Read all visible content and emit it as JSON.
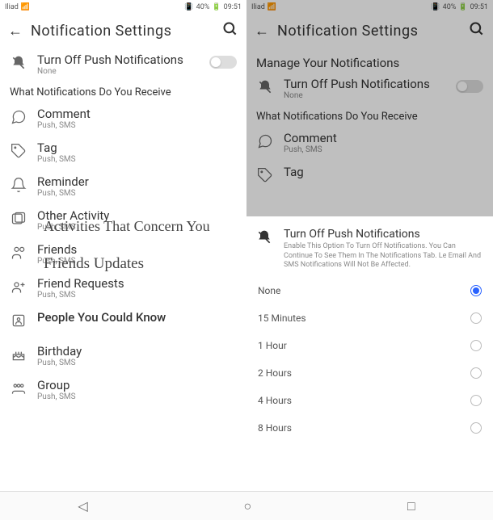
{
  "status": {
    "carrier": "Iliad",
    "battery": "40%",
    "time": "09:51"
  },
  "left": {
    "header_title": "Notification Settings",
    "toggle": {
      "title": "Turn Off Push Notifications",
      "sub": "None"
    },
    "section_label": "What Notifications Do You Receive",
    "items": [
      {
        "title": "Comment",
        "sub": "Push, SMS"
      },
      {
        "title": "Tag",
        "sub": "Push, SMS"
      },
      {
        "title": "Reminder",
        "sub": "Push, SMS"
      },
      {
        "title": "Other Activity",
        "sub": "Push, SMS"
      },
      {
        "title": "Friends",
        "sub": "Push, SMS"
      },
      {
        "title": "Friend Requests",
        "sub": "Push, SMS"
      },
      {
        "title": "People You Could Know",
        "sub": ""
      },
      {
        "title": "Birthday",
        "sub": "Push, SMS"
      },
      {
        "title": "Group",
        "sub": "Push, SMS"
      }
    ],
    "overlay1": "Activities That Concern You",
    "overlay2": "Friends Updates"
  },
  "right": {
    "header_title": "Notification Settings",
    "manage": "Manage Your Notifications",
    "toggle": {
      "title": "Turn Off Push Notifications",
      "sub": "None"
    },
    "section_label": "What Notifications Do You Receive",
    "items": [
      {
        "title": "Comment",
        "sub": "Push, SMS"
      },
      {
        "title": "Tag",
        "sub": ""
      }
    ],
    "sheet": {
      "title": "Turn Off Push Notifications",
      "desc": "Enable This Option To Turn Off Notifications. You Can Continue To See Them In The Notifications Tab. Le Email And SMS Notifications Will Not Be Affected.",
      "options": [
        "None",
        "15 Minutes",
        "1 Hour",
        "2 Hours",
        "4 Hours",
        "8 Hours"
      ],
      "selected": 0
    }
  },
  "nav": {
    "back": "◁",
    "home": "○",
    "recent": "□"
  }
}
